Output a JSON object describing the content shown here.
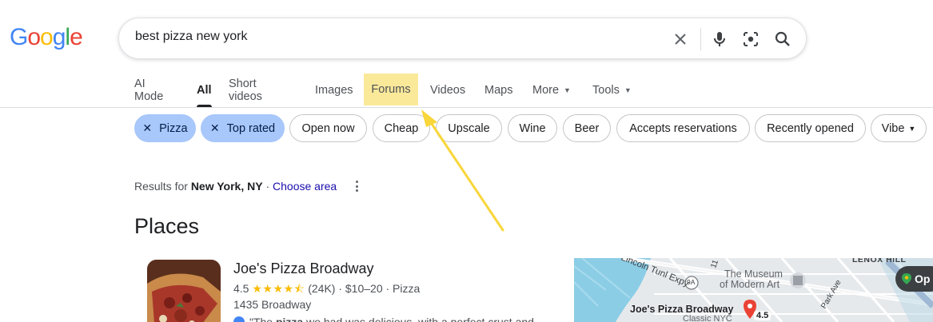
{
  "logo": {
    "letters": [
      "G",
      "o",
      "o",
      "g",
      "l",
      "e"
    ],
    "colors": [
      "#4285f4",
      "#ea4335",
      "#fbbc05",
      "#4285f4",
      "#34a853",
      "#ea4335"
    ]
  },
  "search": {
    "query": "best pizza new york",
    "icons": [
      "close-icon",
      "mic-icon",
      "lens-icon",
      "search-icon"
    ]
  },
  "tabs": [
    {
      "label": "AI Mode"
    },
    {
      "label": "All"
    },
    {
      "label": "Short videos"
    },
    {
      "label": "Images"
    },
    {
      "label": "Forums"
    },
    {
      "label": "Videos"
    },
    {
      "label": "Maps"
    },
    {
      "label": "More"
    },
    {
      "label": "Tools"
    }
  ],
  "chips": [
    {
      "label": "Pizza"
    },
    {
      "label": "Top rated"
    },
    {
      "label": "Open now"
    },
    {
      "label": "Cheap"
    },
    {
      "label": "Upscale"
    },
    {
      "label": "Wine"
    },
    {
      "label": "Beer"
    },
    {
      "label": "Accepts reservations"
    },
    {
      "label": "Recently opened"
    },
    {
      "label": "Vibe"
    }
  ],
  "location": {
    "prefix": "Results for ",
    "place": "New York, NY",
    "separator": " · ",
    "choose": "Choose area"
  },
  "places": {
    "title": "Places",
    "items": [
      {
        "name": "Joe's Pizza Broadway",
        "rating": "4.5",
        "stars": "★★★★⯪",
        "reviews": "(24K) · $10–20 · Pizza",
        "address": "1435 Broadway",
        "review_pre": "\"The ",
        "review_bold": "pizza",
        "review_post": " we had was delicious, with a perfect crust and"
      }
    ]
  },
  "map": {
    "labels": [
      "Lincoln Tunl Expy",
      "LENOX HILL",
      "The Museum",
      "of Modern Art",
      "Park Ave",
      "9A",
      "11",
      "Joe's Pizza Broadway",
      "Classic NYC",
      "4.5"
    ],
    "open_label": "Op"
  },
  "colors": {
    "highlight": "#fbe99a",
    "arrow": "#f9d63a",
    "chip_selected": "#a8c7fa",
    "link": "#1a0dab"
  }
}
